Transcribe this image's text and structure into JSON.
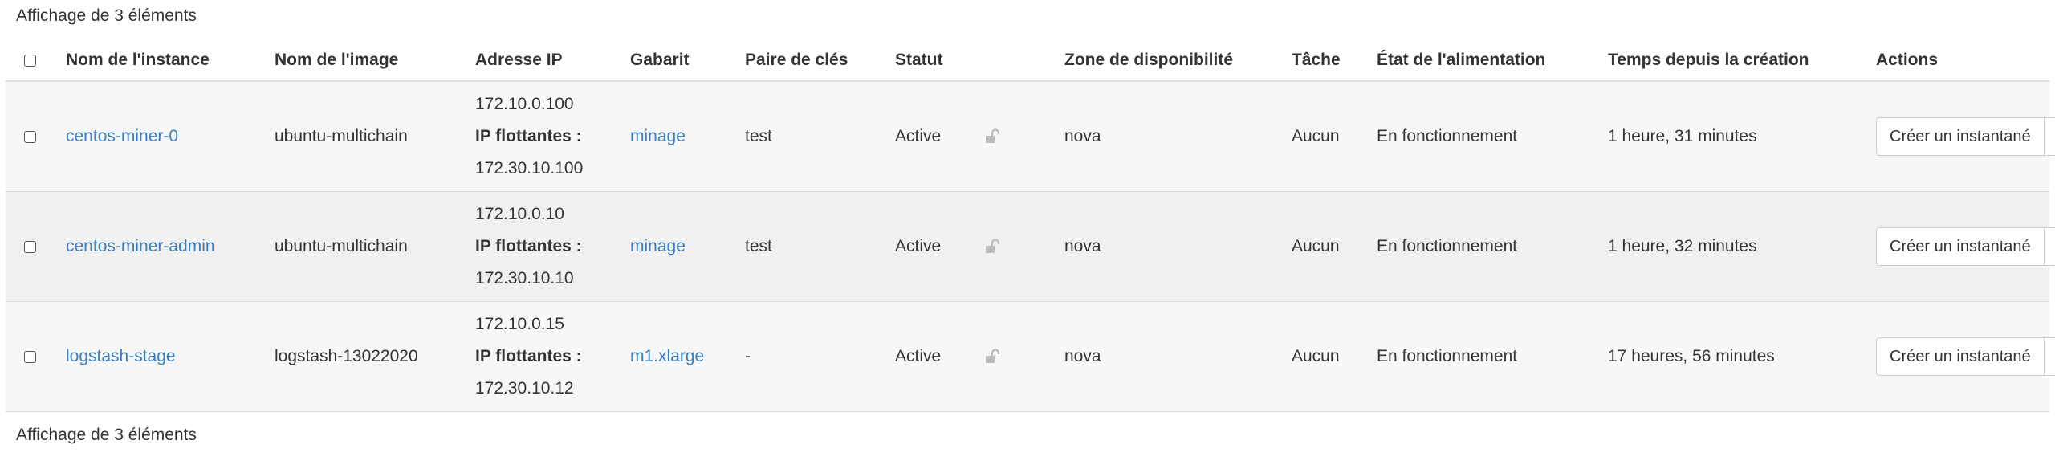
{
  "summary": {
    "top": "Affichage de 3 éléments",
    "bottom": "Affichage de 3 éléments"
  },
  "columns": {
    "name": "Nom de l'instance",
    "image": "Nom de l'image",
    "ip": "Adresse IP",
    "flavor": "Gabarit",
    "keypair": "Paire de clés",
    "status": "Statut",
    "az": "Zone de disponibilité",
    "task": "Tâche",
    "power": "État de l'alimentation",
    "age": "Temps depuis la création",
    "actions": "Actions"
  },
  "rows": [
    {
      "name": "centos-miner-0",
      "image": "ubuntu-multichain",
      "ip_fixed": "172.10.0.100",
      "ip_float_label": "IP flottantes :",
      "ip_float": "172.30.10.100",
      "flavor": "minage",
      "keypair": "test",
      "status": "Active",
      "lock_icon": "unlocked-icon",
      "az": "nova",
      "task": "Aucun",
      "power": "En fonctionnement",
      "age": "1 heure, 31 minutes",
      "action": "Créer un instantané"
    },
    {
      "name": "centos-miner-admin",
      "image": "ubuntu-multichain",
      "ip_fixed": "172.10.0.10",
      "ip_float_label": "IP flottantes :",
      "ip_float": "172.30.10.10",
      "flavor": "minage",
      "keypair": "test",
      "status": "Active",
      "lock_icon": "unlocked-icon",
      "az": "nova",
      "task": "Aucun",
      "power": "En fonctionnement",
      "age": "1 heure, 32 minutes",
      "action": "Créer un instantané"
    },
    {
      "name": "logstash-stage",
      "image": "logstash-13022020",
      "ip_fixed": "172.10.0.15",
      "ip_float_label": "IP flottantes :",
      "ip_float": "172.30.10.12",
      "flavor": "m1.xlarge",
      "keypair": "-",
      "status": "Active",
      "lock_icon": "unlocked-icon",
      "az": "nova",
      "task": "Aucun",
      "power": "En fonctionnement",
      "age": "17 heures, 56 minutes",
      "action": "Créer un instantané"
    }
  ],
  "colors": {
    "link": "#3a7fc1",
    "row_bg": "#f7f7f7",
    "border": "#dddddd",
    "text": "#333333"
  }
}
